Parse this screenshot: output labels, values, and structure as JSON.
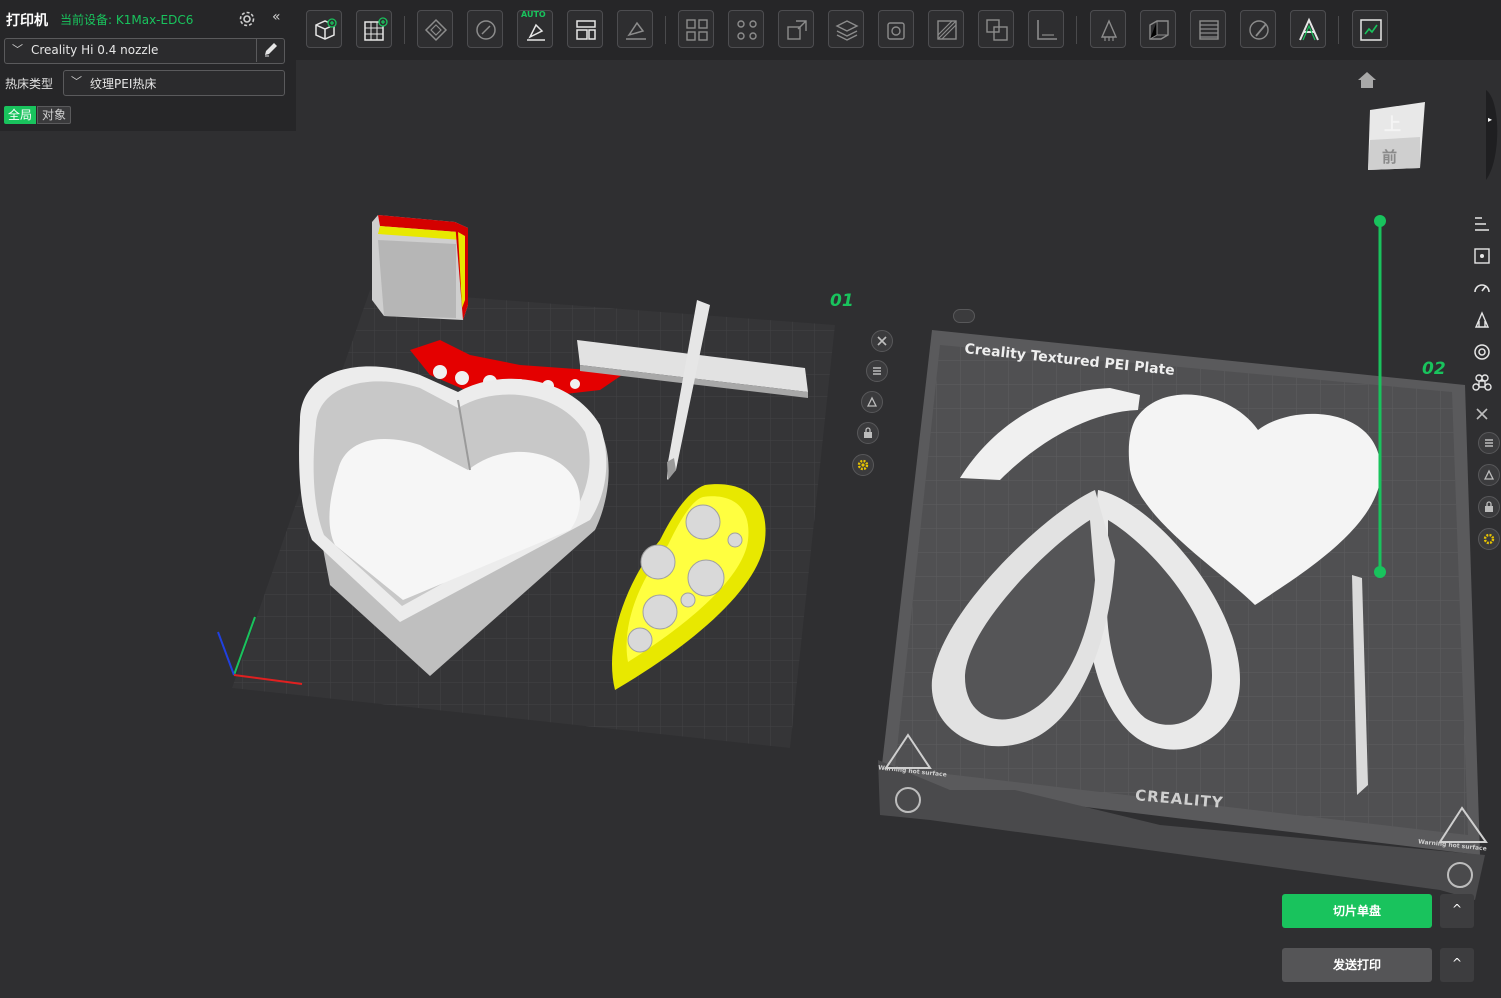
{
  "printer_panel": {
    "title": "打印机",
    "current_device": "当前设备: K1Max-EDC6",
    "nozzle_profile": "Creality Hi 0.4 nozzle",
    "bed_type_label": "热床类型",
    "bed_type_value": "纹理PEI热床",
    "scope_global": "全局",
    "scope_object": "对象",
    "collapse_glyph": "«"
  },
  "toolbar": {
    "auto_badge": "AUTO",
    "icons": [
      "add-object-icon",
      "add-plate-icon",
      "auto-orient-icon",
      "arrange-icon",
      "auto-place-icon",
      "split-layout-icon",
      "face-place-icon",
      "arrange-grid-icon",
      "split-objects-icon",
      "scale-icon",
      "layer-stack-icon",
      "hollow-icon",
      "cut-icon",
      "boolean-icon",
      "measure-icon",
      "support-paint-icon",
      "variable-layer-icon",
      "assembly-icon",
      "color-paint-icon",
      "text-icon",
      "preview-icon"
    ]
  },
  "viewport": {
    "plate1_number": "01",
    "plate2_number": "02",
    "plate2_title": "Creality Textured PEI Plate",
    "plate2_brand": "CREALITY",
    "warning_text": "Warning hot surface",
    "view_cube_top": "上",
    "view_cube_front": "前"
  },
  "actions": {
    "slice_label": "切片单盘",
    "send_label": "发送打印",
    "caret": "^"
  },
  "colors": {
    "accent": "#19c35d",
    "panel_bg": "#262628",
    "canvas_bg": "#2f2f31",
    "model_white": "#e4e4e4",
    "highlight_yellow": "#f2f200",
    "highlight_red": "#e80000"
  }
}
